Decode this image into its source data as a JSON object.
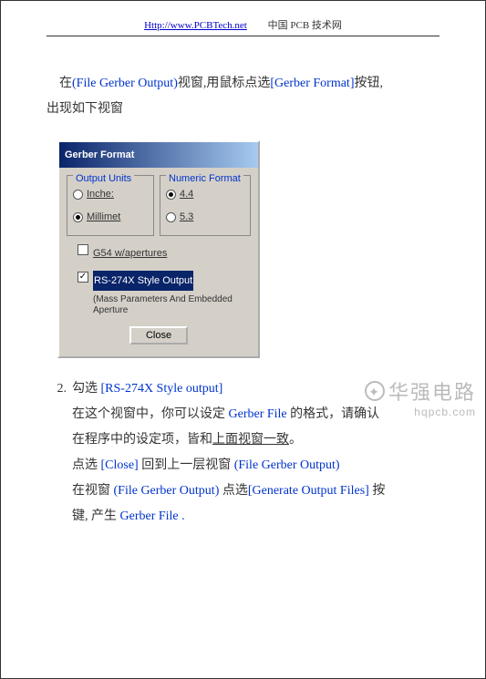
{
  "header": {
    "link": "Http://www.PCBTech.net",
    "site_name": "中国 PCB 技术网"
  },
  "intro": {
    "part1": "在",
    "part2": "(File Gerber Output)",
    "part3": "视窗,用鼠标点选",
    "part4": "[Gerber Format]",
    "part5": "按钮,",
    "part6": "出现如下视窗"
  },
  "dialog": {
    "title": "Gerber Format",
    "output_units": {
      "legend": "Output Units",
      "opt1": "Inche:",
      "opt2": "Millimet"
    },
    "numeric_format": {
      "legend": "Numeric Format",
      "opt1": "4.4",
      "opt2": "5.3"
    },
    "cb1": "G54 w/apertures",
    "cb2": "RS-274X Style Output",
    "cb2_sub": "(Mass Parameters And Embedded Aperture",
    "close": "Close"
  },
  "list": {
    "num": "2.",
    "line1a": "勾选  ",
    "line1b": "[RS-274X Style output]",
    "line2a": "在这个视窗中，你可以设定 ",
    "line2b": "Gerber File ",
    "line2c": "的格式，请确认",
    "line3a": "在程序中的设定项，皆和",
    "line3b": "上面视窗一致",
    "line3c": "。",
    "line4a": "点选  ",
    "line4b": "[Close]  ",
    "line4c": "回到上一层视窗  ",
    "line4d": "(File Gerber Output)",
    "line5a": "在视窗  ",
    "line5b": "(File Gerber Output)  ",
    "line5c": "点选",
    "line5d": "[Generate Output Files]  ",
    "line5e": "按",
    "line6a": "键,  产生 ",
    "line6b": "Gerber File ."
  },
  "watermark": {
    "icon": "✦",
    "main": "华强电路",
    "sub": "hqpcb.com"
  }
}
